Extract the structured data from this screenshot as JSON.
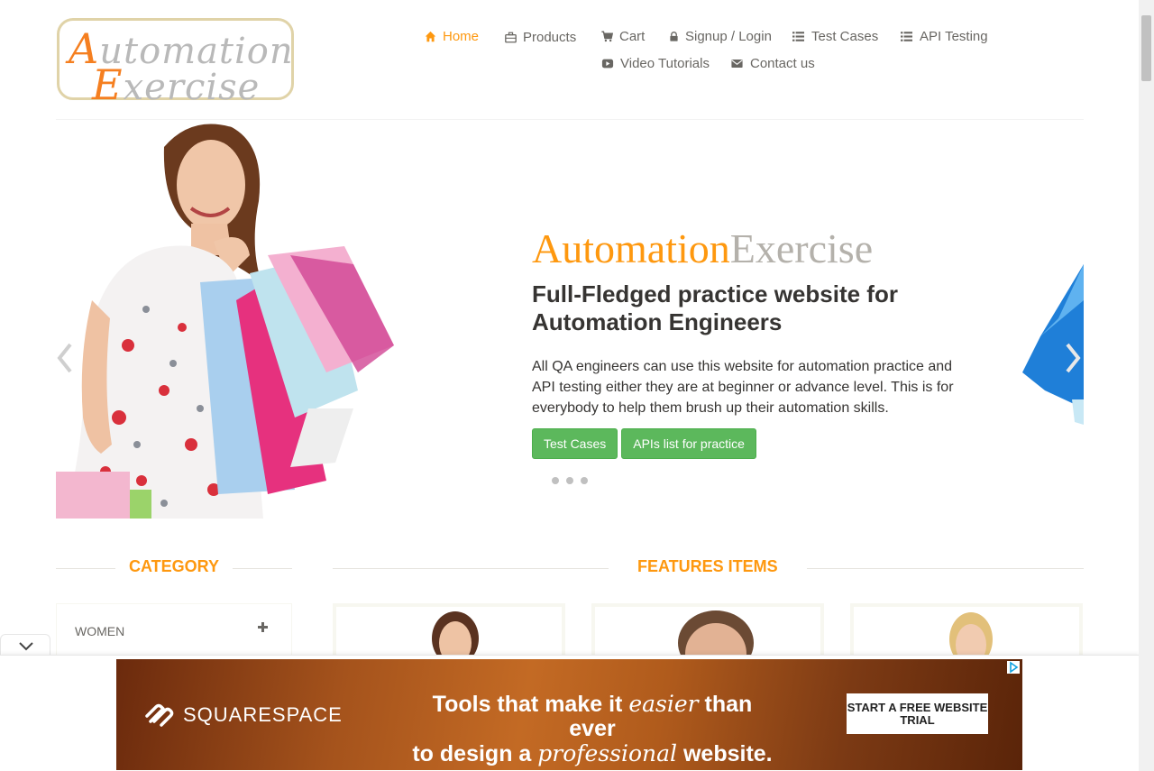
{
  "logo": {
    "line1_accent": "A",
    "line1_rest": "utomation",
    "line2_accent": "E",
    "line2_rest": "xercise"
  },
  "nav": [
    {
      "label": "Home",
      "icon": "home-icon"
    },
    {
      "label": "Products",
      "icon": "briefcase-icon"
    },
    {
      "label": "Cart",
      "icon": "shopping-cart-icon"
    },
    {
      "label": "Signup / Login",
      "icon": "lock-icon"
    },
    {
      "label": "Test Cases",
      "icon": "list-icon"
    },
    {
      "label": "API Testing",
      "icon": "list-icon"
    },
    {
      "label": "Video Tutorials",
      "icon": "youtube-play-icon"
    },
    {
      "label": "Contact us",
      "icon": "envelope-icon"
    }
  ],
  "hero": {
    "brand_a": "Automation",
    "brand_b": "Exercise",
    "title": "Full-Fledged practice website for Automation Engineers",
    "description": "All QA engineers can use this website for automation practice and API testing either they are at beginner or advance level. This is for everybody to help them brush up their automation skills.",
    "btn_test_cases": "Test Cases",
    "btn_apis": "APIs list for practice"
  },
  "sections": {
    "category": "CATEGORY",
    "features": "FEATURES ITEMS"
  },
  "categories": [
    {
      "label": "WOMEN"
    }
  ],
  "ad": {
    "brand": "SQUARESPACE",
    "line1_a": "Tools that make it ",
    "line1_em": "easier",
    "line1_b": " than ever",
    "line2_a": "to design a ",
    "line2_em": "professional",
    "line2_b": " website.",
    "cta": "START A FREE WEBSITE TRIAL"
  },
  "colors": {
    "accent": "#fe980f",
    "button": "#5cb85c",
    "brand_orange": "#f57f20"
  }
}
